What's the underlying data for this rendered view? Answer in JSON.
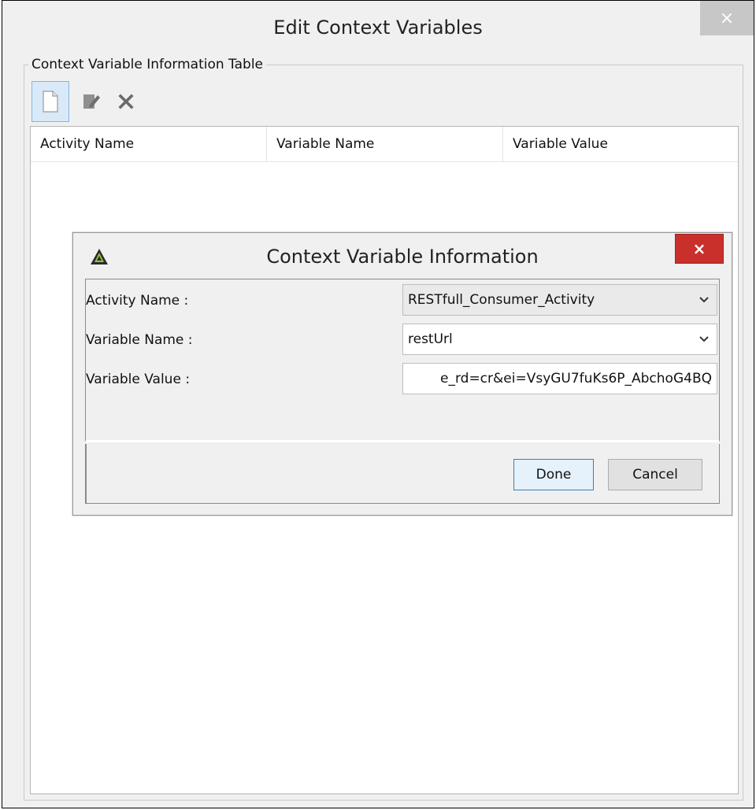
{
  "window": {
    "title": "Edit Context Variables",
    "close_label": "×"
  },
  "group": {
    "legend": "Context Variable Information Table"
  },
  "toolbar": {
    "new_icon": "new-document-icon",
    "edit_icon": "edit-icon",
    "delete_icon": "delete-icon"
  },
  "table": {
    "columns": [
      "Activity Name",
      "Variable Name",
      "Variable Value"
    ]
  },
  "dialog": {
    "title": "Context Variable Information",
    "close_label": "×",
    "fields": [
      {
        "label": "Activity Name :",
        "value": "RESTfull_Consumer_Activity",
        "type": "select"
      },
      {
        "label": "Variable Name :",
        "value": "restUrl",
        "type": "select"
      },
      {
        "label": "Variable Value :",
        "value": "e_rd=cr&ei=VsyGU7fuKs6P_AbchoG4BQ",
        "type": "text"
      }
    ],
    "done_label": "Done",
    "cancel_label": "Cancel"
  },
  "colors": {
    "dialog_close_bg": "#c9302c",
    "done_border": "#3c7fb1"
  }
}
